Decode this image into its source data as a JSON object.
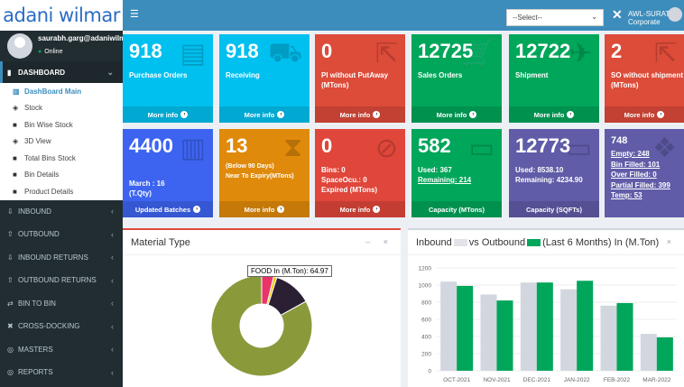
{
  "brand": {
    "name": "adani wilmar"
  },
  "topbar": {
    "menu_icon": "hamburger-icon",
    "select_value": "--Select--",
    "tools_icon": "cross-tools-icon",
    "company": "AWL-SURAT Corporate"
  },
  "user": {
    "name": "saurabh.garg@adaniwilmar",
    "status": "Online"
  },
  "sidebar": {
    "dashboard": "DASHBOARD",
    "submenu": [
      {
        "label": "DashBoard Main",
        "icon": "bar-chart-icon"
      },
      {
        "label": "Stock",
        "icon": "cube-icon"
      },
      {
        "label": "Bin Wise Stock",
        "icon": "box-icon"
      },
      {
        "label": "3D View",
        "icon": "cube-icon"
      },
      {
        "label": "Total Bins Stock",
        "icon": "box-icon"
      },
      {
        "label": "Bin Details",
        "icon": "box-icon"
      },
      {
        "label": "Product Details",
        "icon": "box-icon"
      }
    ],
    "items": [
      {
        "label": "INBOUND",
        "icon": "inbound-icon"
      },
      {
        "label": "OUTBOUND",
        "icon": "outbound-icon"
      },
      {
        "label": "INBOUND RETURNS",
        "icon": "inbound-returns-icon"
      },
      {
        "label": "OUTBOUND RETURNS",
        "icon": "outbound-returns-icon"
      },
      {
        "label": "BIN TO BIN",
        "icon": "exchange-icon"
      },
      {
        "label": "CROSS-DOCKING",
        "icon": "cross-docking-icon"
      },
      {
        "label": "MASTERS",
        "icon": "masters-icon"
      },
      {
        "label": "REPORTS",
        "icon": "reports-icon"
      }
    ]
  },
  "tiles_row1": [
    {
      "value": "918",
      "label": "Purchase Orders",
      "footer": "More info",
      "color": "#00c0ef"
    },
    {
      "value": "918",
      "label": "Receiving",
      "footer": "More info",
      "color": "#00c0ef"
    },
    {
      "value": "0",
      "label": "PI without PutAway (MTons)",
      "footer": "More info",
      "color": "#dd4b39"
    },
    {
      "value": "12725",
      "label": "Sales Orders",
      "footer": "More info",
      "color": "#00a65a"
    },
    {
      "value": "12722",
      "label": "Shipment",
      "footer": "More info",
      "color": "#00a65a"
    },
    {
      "value": "2",
      "label": "SO without shipment (MTons)",
      "footer": "More info",
      "color": "#dd4b39"
    }
  ],
  "tiles_row2": [
    {
      "value": "4400",
      "line1": "March : 16",
      "line2": "(T.Qty)",
      "footer": "Updated Batches",
      "color": "#3d64f0"
    },
    {
      "value": "13",
      "line1": "(Below 90 Days)",
      "line2": "Near To Expiry(MTons)",
      "footer": "More info",
      "color": "#e08a0b"
    },
    {
      "value": "0",
      "line1": "Bins: 0",
      "line2": "SpaceOcu.: 0",
      "line3": "Expired (MTons)",
      "footer": "More info",
      "color": "#e0463a"
    },
    {
      "value": "582",
      "line1": "Used: 367",
      "line2": "Remaining: 214",
      "footer": "Capacity (MTons)",
      "color": "#00a65a"
    },
    {
      "value": "12773",
      "line1": "Used: 8538.10",
      "line2": "Remaining: 4234.90",
      "footer": "Capacity (SQFTs)",
      "color": "#605ca8"
    },
    {
      "value": "748",
      "links": [
        "Empty: 248",
        "Bin Filled: 101",
        "Over Filled: 0",
        "Partial Filled: 399",
        "Temp: 53"
      ],
      "color": "#605ca8"
    }
  ],
  "panels": {
    "material": {
      "title": "Material Type",
      "tools": "– ×",
      "tooltip": "FOOD In (M.Ton): 64.97"
    },
    "inout": {
      "title_a": "Inbound",
      "title_b": "vs Outbound",
      "title_c": "(Last 6 Months) In (M.Ton)",
      "tools": "– ×"
    }
  },
  "chart_data": [
    {
      "type": "pie",
      "title": "Material Type",
      "slices": [
        {
          "label": "FOOD",
          "value": 64.97,
          "color": "#8a9a3b"
        },
        {
          "label": "",
          "value": 3.0,
          "color": "#e8336b"
        },
        {
          "label": "",
          "value": 0.8,
          "color": "#f2c500"
        },
        {
          "label": "",
          "value": 9.5,
          "color": "#2a1f33"
        }
      ]
    },
    {
      "type": "bar",
      "title": "Inbound vs Outbound (Last 6 Months) In (M.Ton)",
      "categories": [
        "OCT-2021",
        "NOV-2021",
        "DEC-2021",
        "JAN-2022",
        "FEB-2022",
        "MAR-2022"
      ],
      "series": [
        {
          "name": "Inbound",
          "values": [
            1040,
            890,
            1030,
            950,
            760,
            430
          ],
          "color": "#d2d6de"
        },
        {
          "name": "Outbound",
          "values": [
            990,
            820,
            1030,
            1050,
            790,
            390
          ],
          "color": "#00a65a"
        }
      ],
      "yticks": [
        0,
        200,
        400,
        600,
        800,
        1000,
        1200
      ],
      "ylim": [
        0,
        1200
      ],
      "grid": true
    }
  ]
}
